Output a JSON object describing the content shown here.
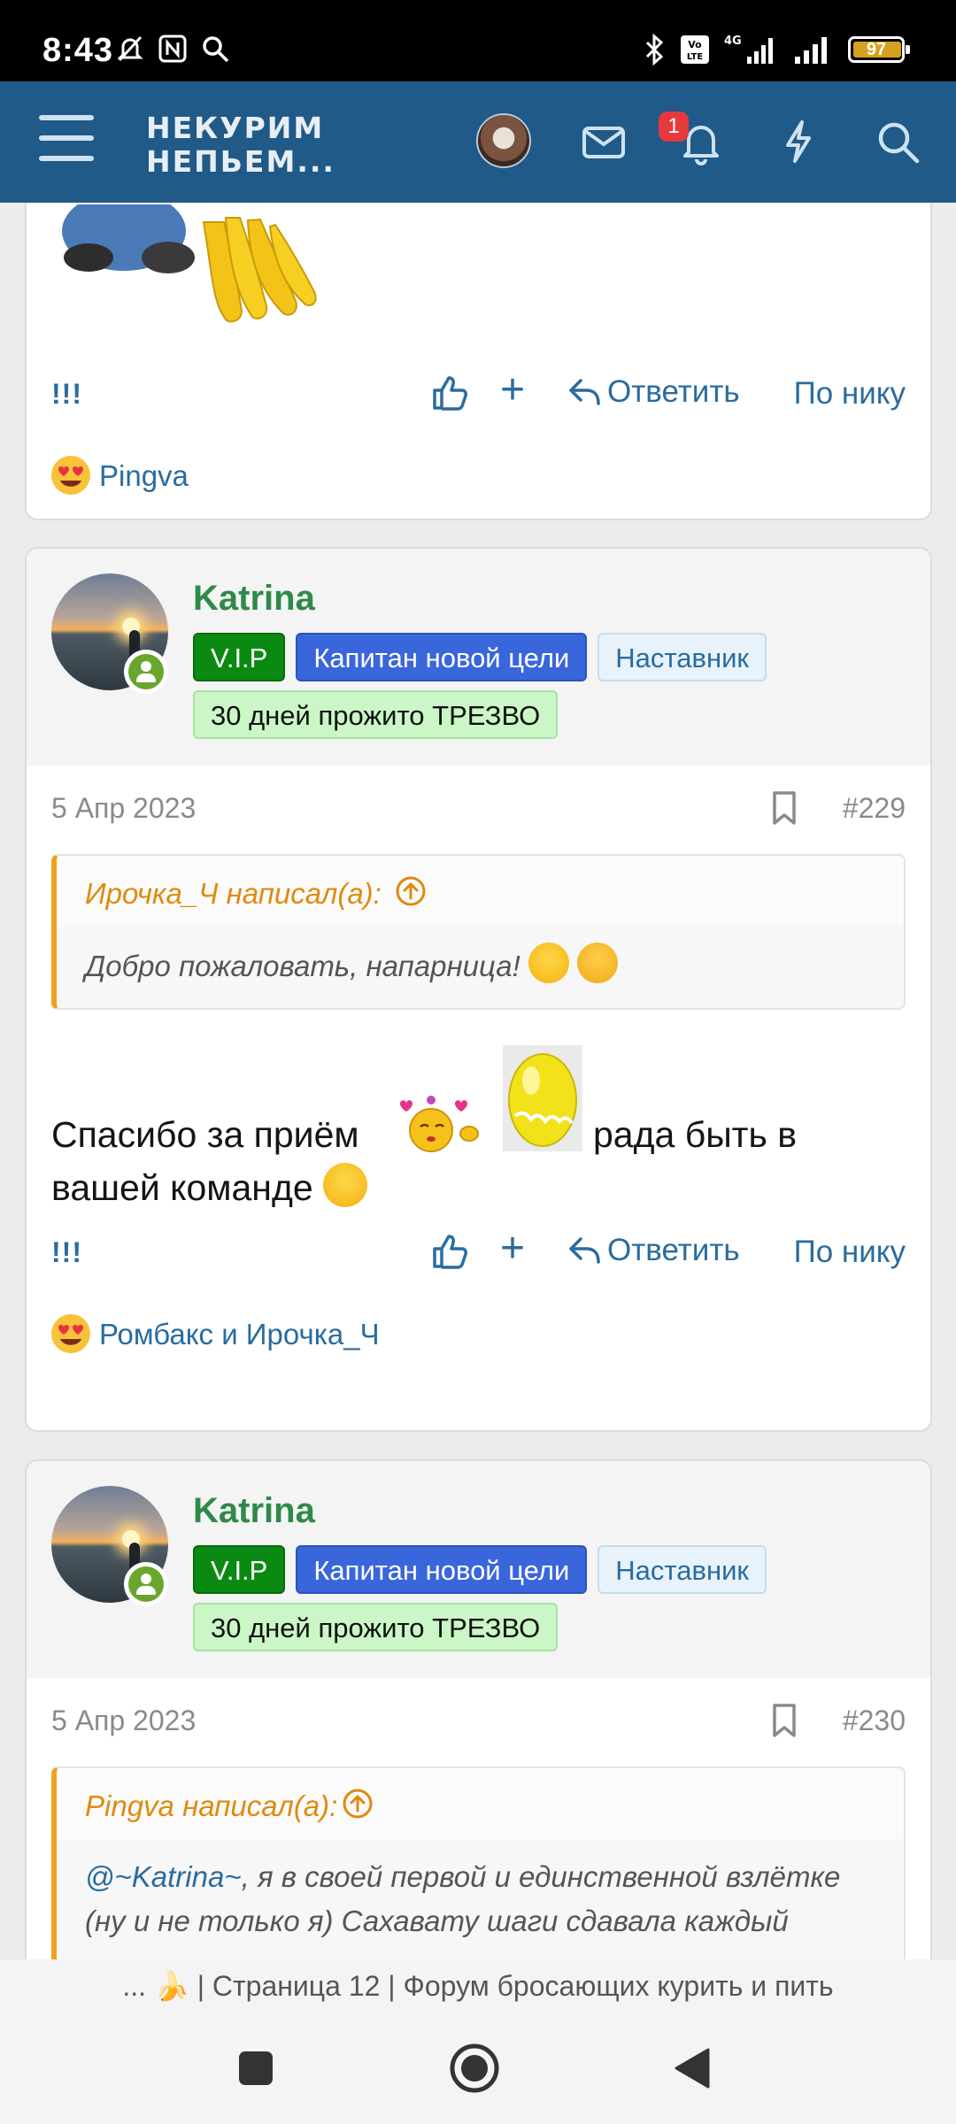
{
  "status_bar": {
    "time": "8:43",
    "battery": "97",
    "network": "4G"
  },
  "header": {
    "logo_line1": "НЕКУРИМ",
    "logo_line2": "НЕПЬЕМ...",
    "notification_count": "1"
  },
  "posts": [
    {
      "actions": {
        "exclaim": "!!!",
        "reply": "Ответить",
        "by_nick": "По нику"
      },
      "reactions": "Pingva"
    },
    {
      "author": "Katrina",
      "badges": [
        "V.I.P",
        "Капитан новой цели",
        "Наставник",
        "30 дней прожито ТРЕЗВО"
      ],
      "date": "5 Апр 2023",
      "number": "#229",
      "quote": {
        "author": "Ирочка_Ч написал(а):",
        "text": "Добро пожаловать, напарница!"
      },
      "message_part1": "Спасибо за приём",
      "message_part2": "рада быть в",
      "message_part3": "вашей команде",
      "actions": {
        "exclaim": "!!!",
        "reply": "Ответить",
        "by_nick": "По нику"
      },
      "reactions": "Ромбакс и Ирочка_Ч"
    },
    {
      "author": "Katrina",
      "badges": [
        "V.I.P",
        "Капитан новой цели",
        "Наставник",
        "30 дней прожито ТРЕЗВО"
      ],
      "date": "5 Апр 2023",
      "number": "#230",
      "quote": {
        "author": "Pingva написал(а):",
        "mention": "@~Katrina~",
        "text_line1": ", я в своей первой и единственной взлётке",
        "text_line2": "(ну и не только я) Сахавату шаги сдавала каждый"
      }
    }
  ],
  "page_title": "... 🍌 | Страница 12 | Форум бросающих курить и пить",
  "colors": {
    "header_bg": "#1f5a88",
    "link": "#2a6c9e",
    "username": "#2f8a4a",
    "quote_accent": "#f0a21c"
  }
}
